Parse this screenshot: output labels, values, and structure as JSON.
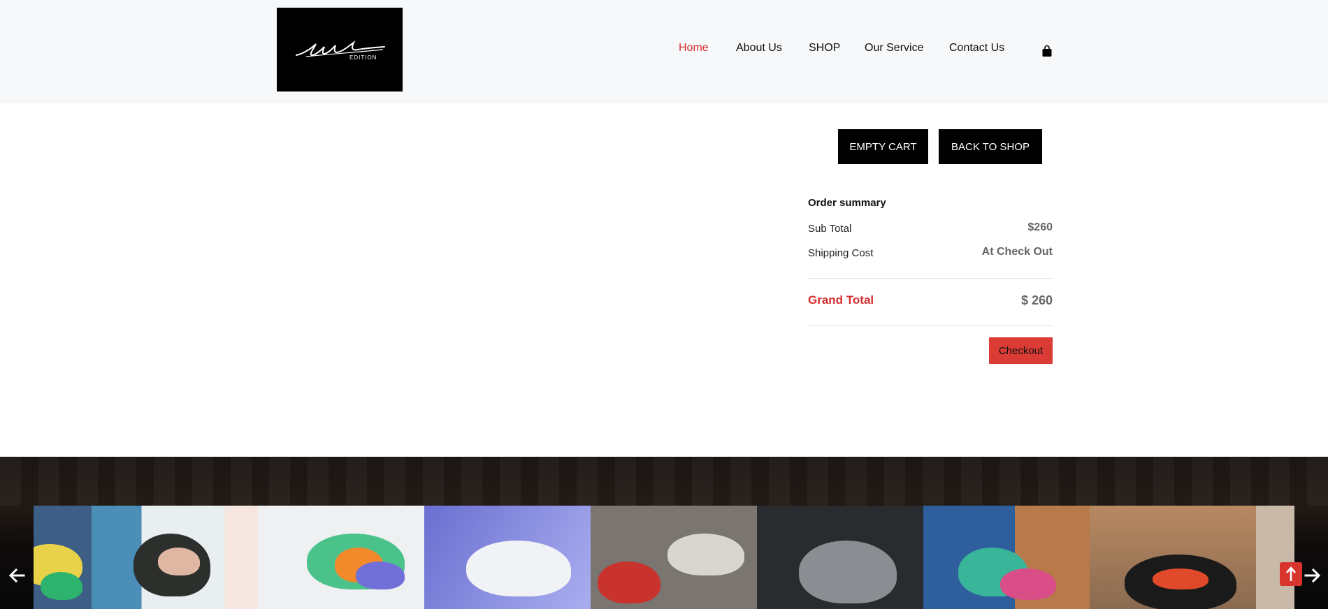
{
  "header": {
    "logo_text": "Limited EDITION",
    "nav": [
      {
        "label": "Home",
        "active": true
      },
      {
        "label": "About Us",
        "active": false
      },
      {
        "label": "SHOP",
        "active": false
      },
      {
        "label": "Our Service",
        "active": false
      },
      {
        "label": "Contact Us",
        "active": false
      }
    ],
    "cart_icon": "shopping-bag-icon"
  },
  "cart_actions": {
    "empty_cart_label": "EMPTY CART",
    "back_to_shop_label": "BACK TO SHOP"
  },
  "summary": {
    "title": "Order summary",
    "sub_total_label": "Sub Total",
    "sub_total_value": "$260",
    "shipping_label": "Shipping Cost",
    "shipping_value": "At Check Out",
    "grand_total_label": "Grand Total",
    "grand_total_value": "$ 260",
    "checkout_label": "Checkout"
  },
  "footer": {
    "gallery_tiles": [
      "sneaker-photo-1",
      "sneaker-photo-2",
      "sneaker-photo-3",
      "sneaker-photo-4",
      "sneaker-photo-5",
      "sneaker-photo-6",
      "sneaker-photo-7",
      "sneaker-photo-8",
      "sneaker-photo-9"
    ],
    "prev_icon": "arrow-left-icon",
    "next_icon": "arrow-right-icon",
    "to_top_icon": "arrow-up-icon"
  },
  "colors": {
    "accent": "#d32f2f",
    "checkout_bg": "#db3b35",
    "button_black": "#000000",
    "header_bg": "#f7f8fa"
  }
}
